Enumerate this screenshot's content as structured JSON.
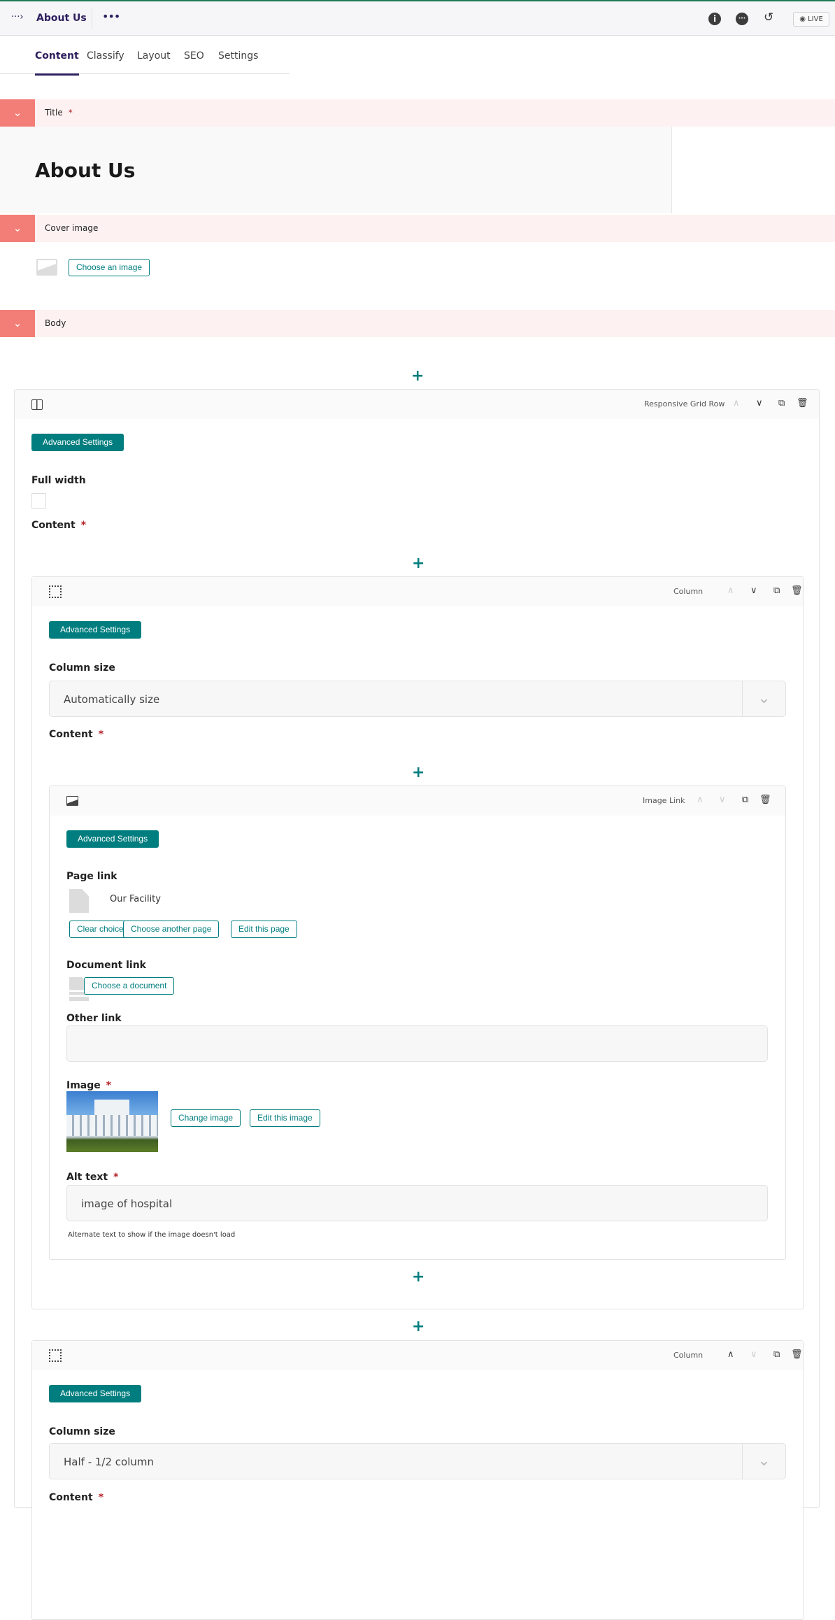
{
  "header": {
    "breadcrumb_icon": "···›",
    "title": "About Us",
    "more": "•••",
    "live_label": "LIVE",
    "icons": [
      "info-icon",
      "comment-icon",
      "history-icon",
      "eye-icon"
    ]
  },
  "tabs": [
    {
      "label": "Content"
    },
    {
      "label": "Classify"
    },
    {
      "label": "Layout"
    },
    {
      "label": "SEO"
    },
    {
      "label": "Settings"
    }
  ],
  "sections": {
    "title_label": "Title",
    "title_value": "About Us",
    "cover_label": "Cover image",
    "cover_button": "Choose an image",
    "body_label": "Body",
    "required": "*"
  },
  "grid_row": {
    "kind": "Responsive Grid Row",
    "advanced": "Advanced Settings",
    "full_width_label": "Full width",
    "content_label": "Content"
  },
  "column1": {
    "kind": "Column",
    "advanced": "Advanced Settings",
    "size_label": "Column size",
    "size_value": "Automatically size",
    "content_label": "Content"
  },
  "image_link": {
    "kind": "Image Link",
    "advanced": "Advanced Settings",
    "page_link_label": "Page link",
    "page_value": "Our Facility",
    "clear": "Clear choice",
    "choose_page": "Choose another page",
    "edit_page": "Edit this page",
    "doc_label": "Document link",
    "choose_doc": "Choose a document",
    "other_label": "Other link",
    "other_value": "",
    "image_label": "Image",
    "change_image": "Change image",
    "edit_image": "Edit this image",
    "alt_label": "Alt text",
    "alt_value": "image of hospital",
    "alt_help": "Alternate text to show if the image doesn't load"
  },
  "column2": {
    "kind": "Column",
    "advanced": "Advanced Settings",
    "size_label": "Column size",
    "size_value": "Half - 1/2 column",
    "content_label": "Content"
  },
  "colors": {
    "accent": "#007d7e",
    "toggle": "#f37e77",
    "band": "#fdf2f1",
    "nav": "#2e1f5e"
  }
}
